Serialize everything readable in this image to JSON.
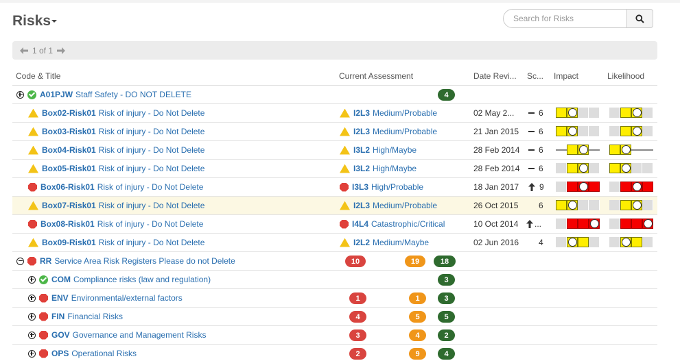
{
  "title": "Risks",
  "search": {
    "placeholder": "Search for Risks"
  },
  "pager": {
    "label": "1 of 1"
  },
  "columns": {
    "code_title": "Code & Title",
    "assessment": "Current Assessment",
    "date": "Date Revi...",
    "score": "Sc...",
    "impact": "Impact",
    "likelihood": "Likelihood"
  },
  "rows": [
    {
      "code": "A01PJW",
      "title": "Staff Safety - DO NOT DELETE",
      "green": "4"
    },
    {
      "code": "Box02-Risk01",
      "title": "Risk of injury - Do Not Delete",
      "assess_code": "I2L3",
      "assess_text": "Medium/Probable",
      "date": "02 May 2...",
      "score": "6"
    },
    {
      "code": "Box03-Risk01",
      "title": "Risk of injury - Do Not Delete",
      "assess_code": "I2L3",
      "assess_text": "Medium/Probable",
      "date": "21 Jan 2015",
      "score": "6"
    },
    {
      "code": "Box04-Risk01",
      "title": "Risk of injury - Do Not Delete",
      "assess_code": "I3L2",
      "assess_text": "High/Maybe",
      "date": "28 Feb 2014",
      "score": "6"
    },
    {
      "code": "Box05-Risk01",
      "title": "Risk of injury - Do Not Delete",
      "assess_code": "I3L2",
      "assess_text": "High/Maybe",
      "date": "28 Feb 2014",
      "score": "6"
    },
    {
      "code": "Box06-Risk01",
      "title": "Risk of injury - Do Not Delete",
      "assess_code": "I3L3",
      "assess_text": "High/Probable",
      "date": "18 Jan 2017",
      "score": "9"
    },
    {
      "code": "Box07-Risk01",
      "title": "Risk of injury - Do Not Delete",
      "assess_code": "I2L3",
      "assess_text": "Medium/Probable",
      "date": "26 Oct 2015",
      "score": "6"
    },
    {
      "code": "Box08-Risk01",
      "title": "Risk of injury - Do Not Delete",
      "assess_code": "I4L4",
      "assess_text": "Catastrophic/Critical",
      "date": "10 Oct 2014",
      "score": "..."
    },
    {
      "code": "Box09-Risk01",
      "title": "Risk of injury - Do Not Delete",
      "assess_code": "I2L2",
      "assess_text": "Medium/Maybe",
      "date": "02 Jun 2016",
      "score": "4"
    },
    {
      "code": "RR",
      "title": "Service Area Risk Registers Please do not Delete",
      "red": "10",
      "orange": "19",
      "green": "18"
    },
    {
      "code": "COM",
      "title": "Compliance risks (law and regulation)",
      "green": "3"
    },
    {
      "code": "ENV",
      "title": "Environmental/external factors",
      "red": "1",
      "orange": "1",
      "green": "3"
    },
    {
      "code": "FIN",
      "title": "Financial Risks",
      "red": "4",
      "orange": "5",
      "green": "5"
    },
    {
      "code": "GOV",
      "title": "Governance and Management Risks",
      "red": "3",
      "orange": "4",
      "green": "2"
    },
    {
      "code": "OPS",
      "title": "Operational Risks",
      "red": "2",
      "orange": "9",
      "green": "4"
    }
  ],
  "colors": {
    "red": "#d9443f",
    "orange": "#f0961a",
    "green": "#2f6b2f",
    "yellow": "#ffee00",
    "link": "#2a6fb0"
  }
}
